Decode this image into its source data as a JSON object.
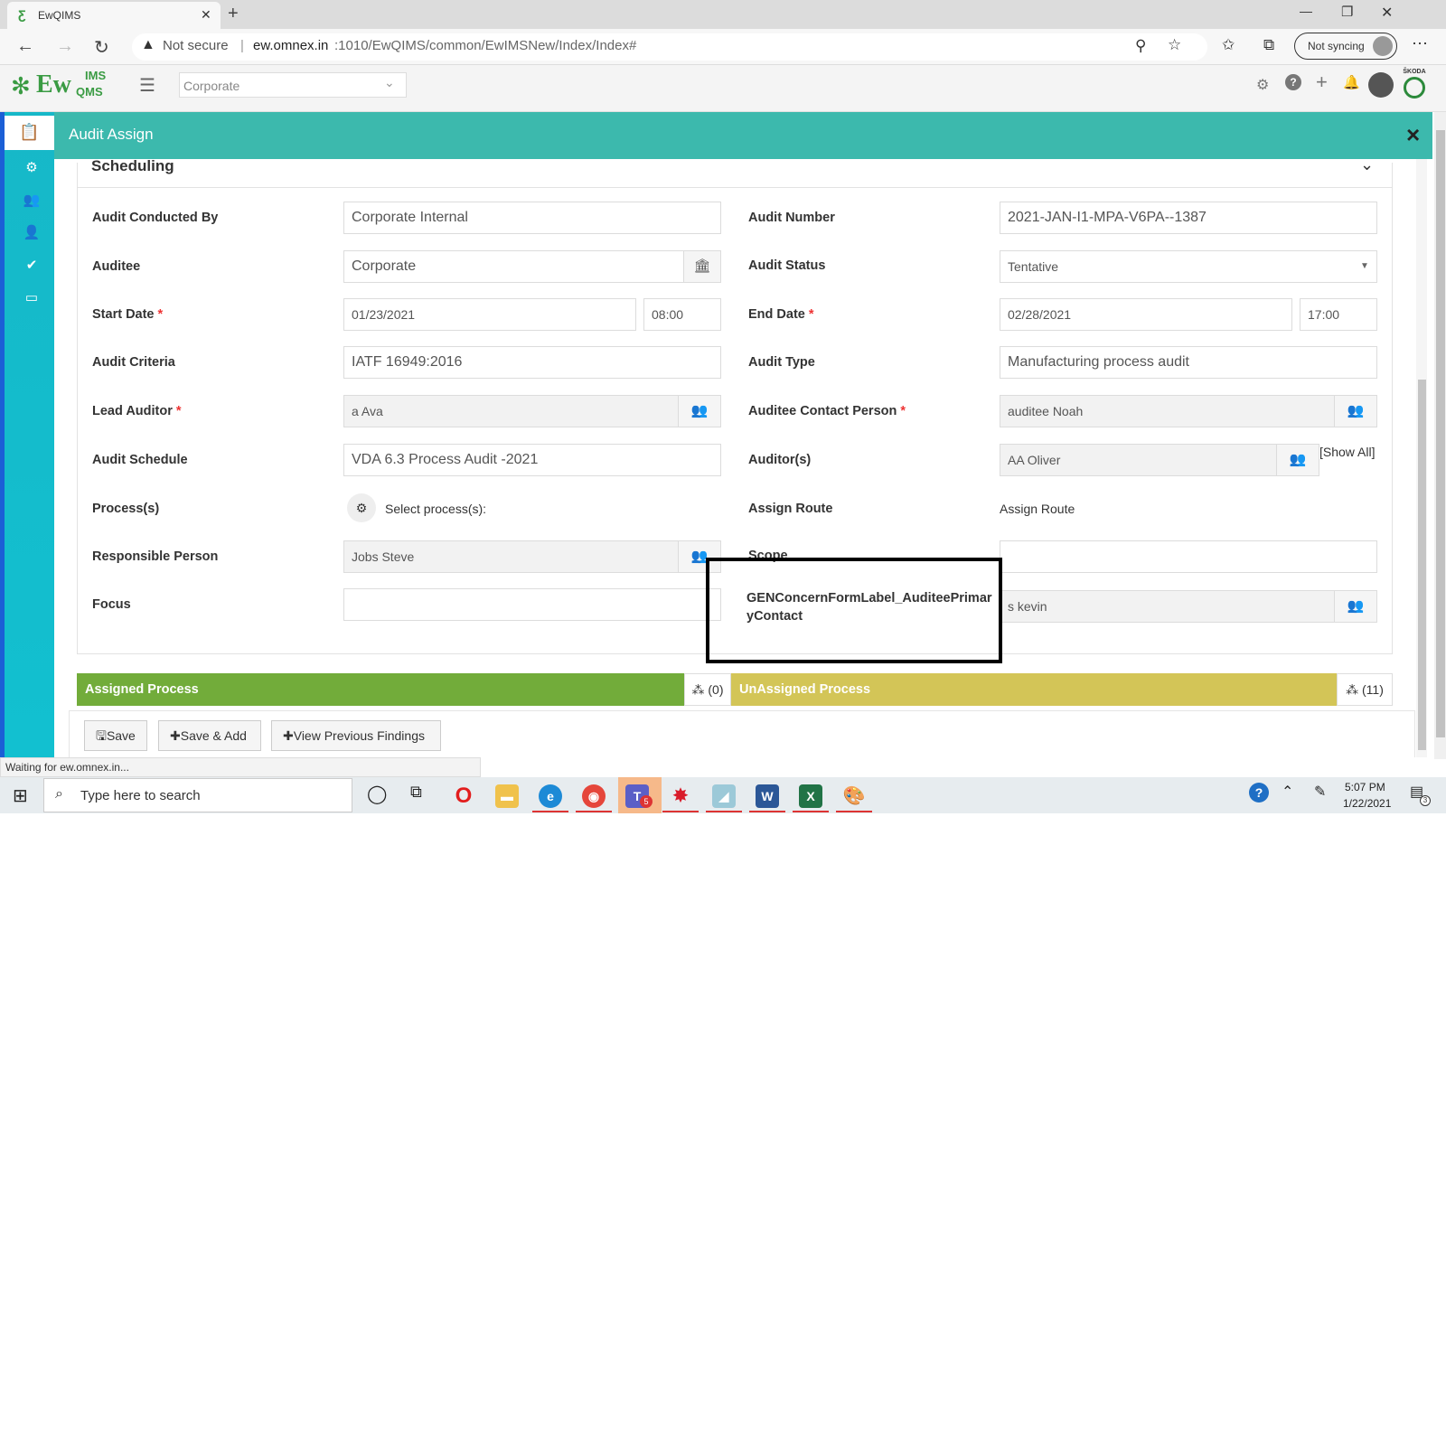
{
  "browser": {
    "tab_title": "EwQIMS",
    "new_tab": "+",
    "security": "Not secure",
    "url_host": "ew.omnex.in",
    "url_rest": ":1010/EwQIMS/common/EwIMSNew/Index/Index#",
    "sync_label": "Not syncing",
    "window_minimize": "—",
    "window_restore": "❐",
    "window_close": "✕"
  },
  "app": {
    "logo_text": "Ew",
    "logo_ims": "IMS",
    "logo_qms": "QMS",
    "corp_select_value": "Corporate",
    "brand_badge": "ŠKODA"
  },
  "modal": {
    "title": "Audit Assign",
    "section_title": "Scheduling",
    "close_label": "×"
  },
  "form": {
    "audit_conducted_by": {
      "label": "Audit Conducted By",
      "value": "Corporate Internal"
    },
    "audit_number": {
      "label": "Audit Number",
      "value": "2021-JAN-I1-MPA-V6PA--1387"
    },
    "auditee": {
      "label": "Auditee",
      "value": "Corporate"
    },
    "audit_status": {
      "label": "Audit Status",
      "value": "Tentative"
    },
    "start_date": {
      "label": "Start Date",
      "date": "01/23/2021",
      "time": "08:00"
    },
    "end_date": {
      "label": "End Date",
      "date": "02/28/2021",
      "time": "17:00"
    },
    "audit_criteria": {
      "label": "Audit Criteria",
      "value": "IATF 16949:2016"
    },
    "audit_type": {
      "label": "Audit Type",
      "value": "Manufacturing process audit"
    },
    "lead_auditor": {
      "label": "Lead Auditor",
      "value": "a Ava"
    },
    "auditee_contact": {
      "label": "Auditee Contact Person",
      "value": "auditee Noah"
    },
    "audit_schedule": {
      "label": "Audit Schedule",
      "value": "VDA 6.3 Process Audit -2021"
    },
    "auditors": {
      "label": "Auditor(s)",
      "value": "AA Oliver",
      "show_all": "[Show All]"
    },
    "processes": {
      "label": "Process(s)",
      "value": "Select process(s):"
    },
    "assign_route": {
      "label": "Assign Route",
      "value": "Assign Route"
    },
    "responsible_person": {
      "label": "Responsible Person",
      "value": "Jobs Steve"
    },
    "scope": {
      "label": "Scope",
      "value": ""
    },
    "focus": {
      "label": "Focus",
      "value": ""
    },
    "auditee_primary_contact": {
      "label_line1": "GENConcernFormLabel_AuditeePrimar",
      "label_line2": "yContact",
      "value": "s kevin"
    },
    "required_mark": "*"
  },
  "process_bars": {
    "assigned_label": "Assigned Process",
    "assigned_count": "(0)",
    "unassigned_label": "UnAssigned Process",
    "unassigned_count": "(11)"
  },
  "buttons": {
    "save": "Save",
    "save_add": "Save & Add",
    "view_previous": "View Previous Findings"
  },
  "status_text": "Waiting for ew.omnex.in...",
  "taskbar": {
    "search_placeholder": "Type here to search",
    "time": "5:07 PM",
    "date": "1/22/2021",
    "teams_badge": "5",
    "notif_badge": "3"
  },
  "colors": {
    "modal_header": "#3cb9ad",
    "sidebar": "#16b8c8",
    "assigned_bar": "#72ac3a",
    "unassigned_bar": "#d3c557",
    "required": "#e33333"
  }
}
